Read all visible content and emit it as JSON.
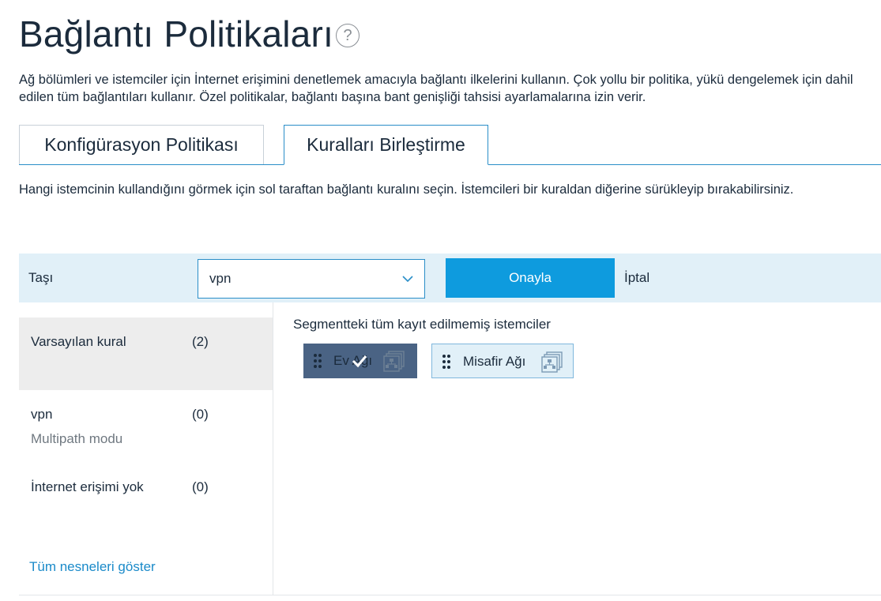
{
  "page": {
    "title": "Bağlantı Politikaları",
    "help_icon": "question-circle-icon",
    "description": "Ağ bölümleri ve istemciler için İnternet erişimini denetlemek amacıyla bağlantı ilkelerini kullanın. Çok yollu bir politika, yükü dengelemek için dahil edilen tüm bağlantıları kullanır. Özel politikalar, bağlantı başına bant genişliği tahsisi ayarlamalarına izin verir."
  },
  "tabs": [
    {
      "label": "Konfigürasyon Politikası",
      "active": false
    },
    {
      "label": "Kuralları Birleştirme",
      "active": true
    }
  ],
  "instructions": "Hangi istemcinin kullandığını görmek için sol taraftan bağlantı kuralını seçin. İstemcileri bir kuraldan diğerine sürükleyip bırakabilirsiniz.",
  "move_bar": {
    "label": "Taşı",
    "selected_value": "vpn",
    "confirm_label": "Onayla",
    "cancel_label": "İptal"
  },
  "rules": [
    {
      "name": "Varsayılan kural",
      "count": "(2)",
      "subtitle": "",
      "selected": true
    },
    {
      "name": "vpn",
      "count": "(0)",
      "subtitle": "Multipath modu",
      "selected": false
    },
    {
      "name": "İnternet erişimi yok",
      "count": "(0)",
      "subtitle": "",
      "selected": false
    }
  ],
  "show_all_label": "Tüm nesneleri göster",
  "segment": {
    "title": "Segmentteki tüm kayıt edilmemiş istemciler",
    "clients": [
      {
        "label": "Ev Ağı",
        "selected": true,
        "icon": "network-icon"
      },
      {
        "label": "Misafir Ağı",
        "selected": false,
        "icon": "network-icon"
      }
    ]
  },
  "colors": {
    "accent": "#0e9bde",
    "tab_border": "#2a8ec8",
    "bar_bg": "#e1f0f8",
    "selected_chip": "#4a6384",
    "link": "#1a8ac9"
  }
}
